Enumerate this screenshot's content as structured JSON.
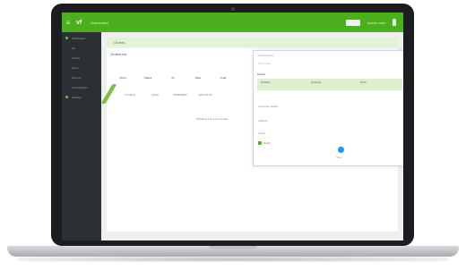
{
  "app": {
    "brand_logo": "vf",
    "title": "Dashboard",
    "user": "Admin user"
  },
  "sidebar": {
    "items": [
      {
        "label": "Dashboard"
      },
      {
        "label": "All"
      },
      {
        "label": "Orders"
      },
      {
        "label": "Items"
      },
      {
        "label": "Reports"
      },
      {
        "label": "Configuration"
      },
      {
        "label": "Settings"
      }
    ]
  },
  "content": {
    "breadcrumb": "Orders",
    "card_title": "Orders list",
    "table_headers": [
      "Order",
      "Status",
      "ID",
      "Date",
      "Total"
    ],
    "row": [
      "Pending",
      "Active",
      "000000000",
      "2019-01-01",
      ""
    ],
    "pager": "Showing 1 to 1 of 1 entries"
  },
  "modal": {
    "title": "Order details",
    "subtitle": "Order date",
    "section_label": "Details",
    "table_headers": [
      "Product",
      "Quantity",
      "Price"
    ],
    "line1": "Customer details",
    "line2": "Address",
    "line3": "Notes",
    "checkbox_label": "Notify",
    "submit_label": "Save"
  },
  "colors": {
    "brand_green": "#4caf1e",
    "sidebar": "#2c2f34",
    "accent_blue": "#2196f3"
  }
}
